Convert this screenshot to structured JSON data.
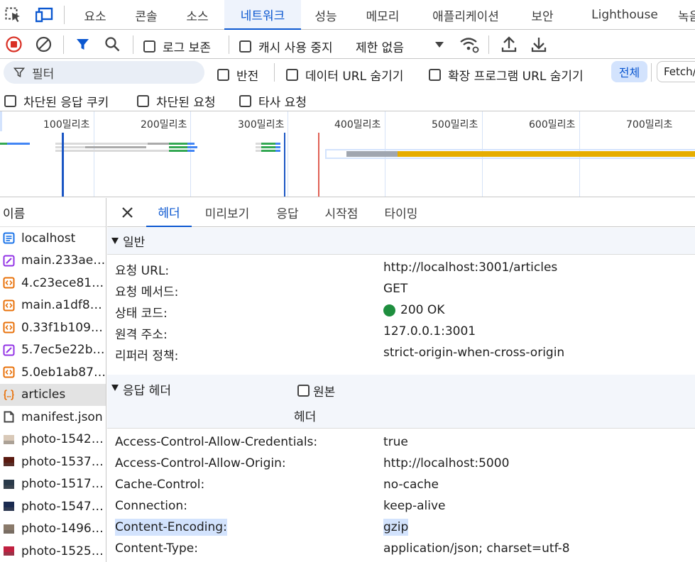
{
  "top_tabs": [
    "요소",
    "콘솔",
    "소스",
    "네트워크",
    "성능",
    "메모리",
    "애플리케이션",
    "보안",
    "Lighthouse",
    "녹음"
  ],
  "active_top_tab": "네트워크",
  "toolbar": {
    "preserve_log": "로그 보존",
    "disable_cache": "캐시 사용 중지",
    "throttling": "제한 없음"
  },
  "filter": {
    "placeholder": "필터",
    "invert": "반전",
    "hide_data_urls": "데이터 URL 숨기기",
    "hide_extension_urls": "확장 프로그램 URL 숨기기",
    "all": "전체",
    "fetch": "Fetch/XHR"
  },
  "block_row": {
    "blocked_cookies": "차단된 응답 쿠키",
    "blocked_requests": "차단된 요청",
    "third_party": "타사 요청"
  },
  "overview": {
    "ticks": [
      "100밀리초",
      "200밀리초",
      "300밀리초",
      "400밀리초",
      "500밀리초",
      "600밀리초",
      "700밀리초"
    ]
  },
  "request_list": {
    "header": "이름",
    "items": [
      {
        "name": "localhost",
        "icon": "document-icon",
        "color": "#1a73e8"
      },
      {
        "name": "main.233ae…",
        "icon": "stylesheet-icon",
        "color": "#9334e6"
      },
      {
        "name": "4.c23ece81.…",
        "icon": "script-icon",
        "color": "#e8710a"
      },
      {
        "name": "main.a1df86…",
        "icon": "script-icon",
        "color": "#e8710a"
      },
      {
        "name": "0.33f1b109.…",
        "icon": "script-icon",
        "color": "#e8710a"
      },
      {
        "name": "5.7ec5e22b.…",
        "icon": "stylesheet-icon",
        "color": "#9334e6"
      },
      {
        "name": "5.0eb1ab87.…",
        "icon": "script-icon",
        "color": "#e8710a"
      },
      {
        "name": "articles",
        "icon": "fetch-icon",
        "color": "#e8710a"
      },
      {
        "name": "manifest.json",
        "icon": "manifest-icon",
        "color": "#444444"
      },
      {
        "name": "photo-1542…",
        "icon": "image-thumb-icon",
        "color": "#d9c9b8"
      },
      {
        "name": "photo-1537…",
        "icon": "image-thumb-icon",
        "color": "#5a1a10"
      },
      {
        "name": "photo-1517…",
        "icon": "image-thumb-icon",
        "color": "#2a3a4a"
      },
      {
        "name": "photo-1547…",
        "icon": "image-thumb-icon",
        "color": "#1a2a50"
      },
      {
        "name": "photo-1496…",
        "icon": "image-thumb-icon",
        "color": "#8a7a6a"
      },
      {
        "name": "photo-1525…",
        "icon": "image-thumb-icon",
        "color": "#c02040"
      }
    ],
    "selected": "articles"
  },
  "details": {
    "tabs": [
      "헤더",
      "미리보기",
      "응답",
      "시작점",
      "타이밍"
    ],
    "active_tab": "헤더",
    "general": {
      "title": "일반",
      "rows": [
        {
          "key": "요청 URL:",
          "value": "http://localhost:3001/articles"
        },
        {
          "key": "요청 메서드:",
          "value": "GET"
        },
        {
          "key": "상태 코드:",
          "value": "200 OK"
        },
        {
          "key": "원격 주소:",
          "value": "127.0.0.1:3001"
        },
        {
          "key": "리퍼러 정책:",
          "value": "strict-origin-when-cross-origin"
        }
      ]
    },
    "response_headers": {
      "title": "응답 헤더",
      "raw_label": "원본",
      "sub_label": "헤더",
      "rows": [
        {
          "key": "Access-Control-Allow-Credentials:",
          "value": "true"
        },
        {
          "key": "Access-Control-Allow-Origin:",
          "value": "http://localhost:5000"
        },
        {
          "key": "Cache-Control:",
          "value": "no-cache"
        },
        {
          "key": "Connection:",
          "value": "keep-alive"
        },
        {
          "key": "Content-Encoding:",
          "value": "gzip"
        },
        {
          "key": "Content-Type:",
          "value": "application/json; charset=utf-8"
        }
      ],
      "highlighted": "Content-Encoding:"
    }
  },
  "colors": {
    "accent": "#0b57d0",
    "status_ok": "#1e8e3e",
    "record_red": "#d93025"
  }
}
